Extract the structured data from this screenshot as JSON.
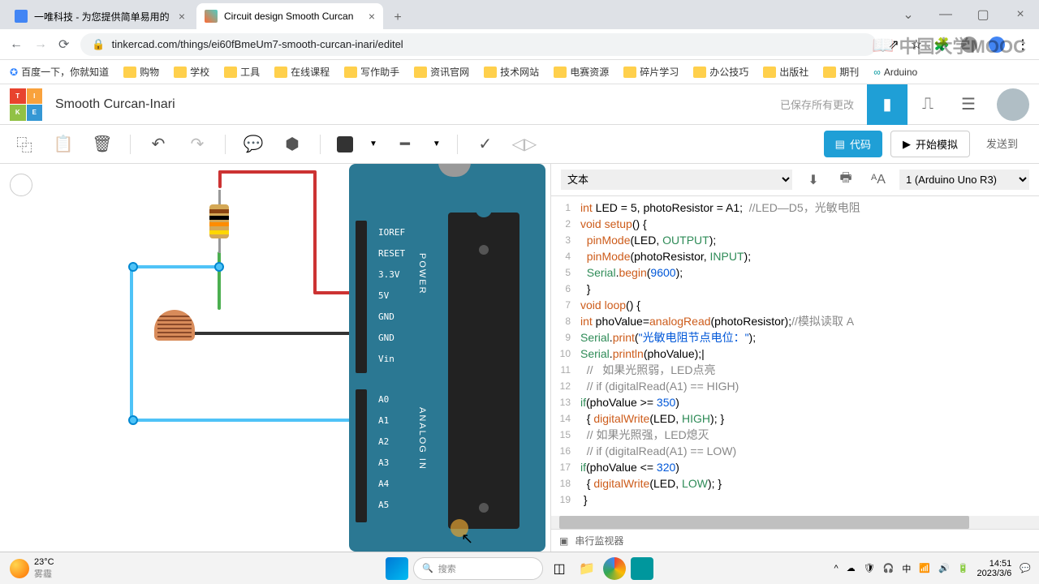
{
  "browser": {
    "tab1": "一唯科技 - 为您提供简单易用的",
    "tab2": "Circuit design Smooth Curcan",
    "url": "tinkercad.com/things/ei60fBmeUm7-smooth-curcan-inari/editel"
  },
  "bookmarks": [
    "百度一下，你就知道",
    "购物",
    "学校",
    "工具",
    "在线课程",
    "写作助手",
    "资讯官网",
    "技术网站",
    "电赛资源",
    "碎片学习",
    "办公技巧",
    "出版社",
    "期刊",
    "Arduino"
  ],
  "tinkercad": {
    "docName": "Smooth Curcan-Inari",
    "saveStatus": "已保存所有更改",
    "codeBtn": "代码",
    "simBtn": "开始模拟",
    "sendBtn": "发送到",
    "codeMode": "文本",
    "boardSel": "1 (Arduino Uno R3)",
    "serialMon": "串行监视器"
  },
  "board": {
    "pins": [
      "IOREF",
      "RESET",
      "3.3V",
      "5V",
      "GND",
      "GND",
      "Vin"
    ],
    "analog": [
      "A0",
      "A1",
      "A2",
      "A3",
      "A4",
      "A5"
    ],
    "powerLbl": "POWER",
    "analogLbl": "ANALOG IN"
  },
  "code": {
    "lines": [
      {
        "n": 1,
        "html": "<span class='ty'>int</span> LED = 5, photoResistor = A1;  <span class='cm'>//LED—D5，光敏电阻</span>"
      },
      {
        "n": 2,
        "html": "<span class='ty'>void</span> <span class='fn'>setup</span>() {"
      },
      {
        "n": 3,
        "html": "  <span class='fn'>pinMode</span>(LED, <span class='kw'>OUTPUT</span>);"
      },
      {
        "n": 4,
        "html": "  <span class='fn'>pinMode</span>(photoResistor, <span class='kw'>INPUT</span>);"
      },
      {
        "n": 5,
        "html": "  <span class='kw'>Serial</span>.<span class='fn'>begin</span>(<span class='str'>9600</span>);"
      },
      {
        "n": 6,
        "html": "  }"
      },
      {
        "n": 7,
        "html": "<span class='ty'>void</span> <span class='fn'>loop</span>() {"
      },
      {
        "n": 8,
        "html": "<span class='ty'>int</span> phoValue=<span class='fn'>analogRead</span>(photoResistor);<span class='cm'>//模拟读取 A</span>"
      },
      {
        "n": 9,
        "html": "<span class='kw'>Serial</span>.<span class='fn'>print</span>(<span class='str'>\"光敏电阻节点电位：\"</span>);"
      },
      {
        "n": 10,
        "html": "<span class='kw'>Serial</span>.<span class='fn'>println</span>(phoValue);|"
      },
      {
        "n": 11,
        "html": "  <span class='cm'>//   如果光照弱，LED点亮</span>"
      },
      {
        "n": 12,
        "html": "  <span class='cm'>// if (digitalRead(A1) == HIGH)</span>"
      },
      {
        "n": 13,
        "html": "<span class='kw'>if</span>(phoValue >= <span class='str'>350</span>)"
      },
      {
        "n": 14,
        "html": "  { <span class='fn'>digitalWrite</span>(LED, <span class='kw'>HIGH</span>); }"
      },
      {
        "n": 15,
        "html": "  <span class='cm'>// 如果光照强，LED熄灭</span>"
      },
      {
        "n": 16,
        "html": "  <span class='cm'>// if (digitalRead(A1) == LOW)</span>"
      },
      {
        "n": 17,
        "html": "<span class='kw'>if</span>(phoValue <= <span class='str'>320</span>)"
      },
      {
        "n": 18,
        "html": "  { <span class='fn'>digitalWrite</span>(LED, <span class='kw'>LOW</span>); }"
      },
      {
        "n": 19,
        "html": " }"
      }
    ]
  },
  "watermark": "中国大学MOOC",
  "taskbar": {
    "temp": "23°C",
    "weather": "雾霾",
    "search": "搜索",
    "ime": "中",
    "time": "14:51",
    "date": "2023/3/6"
  }
}
